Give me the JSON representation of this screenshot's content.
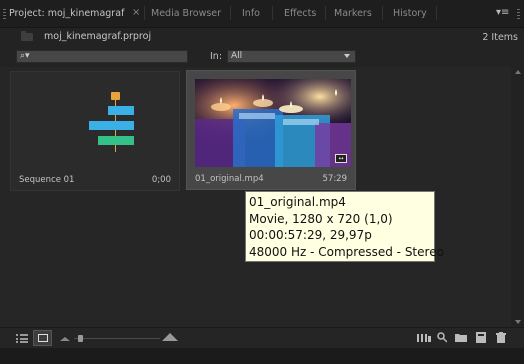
{
  "tabs": [
    {
      "label": "Project: moj_kinemagraf",
      "active": true
    },
    {
      "label": "Media Browser",
      "active": false
    },
    {
      "label": "Info",
      "active": false
    },
    {
      "label": "Effects",
      "active": false
    },
    {
      "label": "Markers",
      "active": false
    },
    {
      "label": "History",
      "active": false
    }
  ],
  "tab_close": "×",
  "panel_menu": "▾≡",
  "project": {
    "file_name": "moj_kinemagraf.prproj",
    "items_count": "2 Items"
  },
  "search": {
    "icon": "⌕▾",
    "in_label": "In:",
    "in_value": "All"
  },
  "items": [
    {
      "name": "Sequence 01",
      "duration": "0;00",
      "type": "sequence",
      "selected": false
    },
    {
      "name": "01_original.mp4",
      "duration": "57:29",
      "type": "video",
      "selected": true
    }
  ],
  "tooltip": {
    "lines": [
      "01_original.mp4",
      "Movie, 1280 x 720 (1,0)",
      "00:00:57:29, 29,97p",
      "48000 Hz - Compressed - Stereo"
    ]
  },
  "colors": {
    "accent_orange": "#e8a33c",
    "seq_blue": "#3ab0e6",
    "seq_green": "#35c08a",
    "tooltip_bg": "#ffffe1"
  },
  "toolbar_icons": [
    "list-view-icon",
    "icon-view-icon",
    "zoom-out-icon",
    "zoom-slider",
    "zoom-in-icon",
    "automate-to-sequence-icon",
    "find-icon",
    "new-bin-icon",
    "new-item-icon",
    "clear-icon"
  ]
}
